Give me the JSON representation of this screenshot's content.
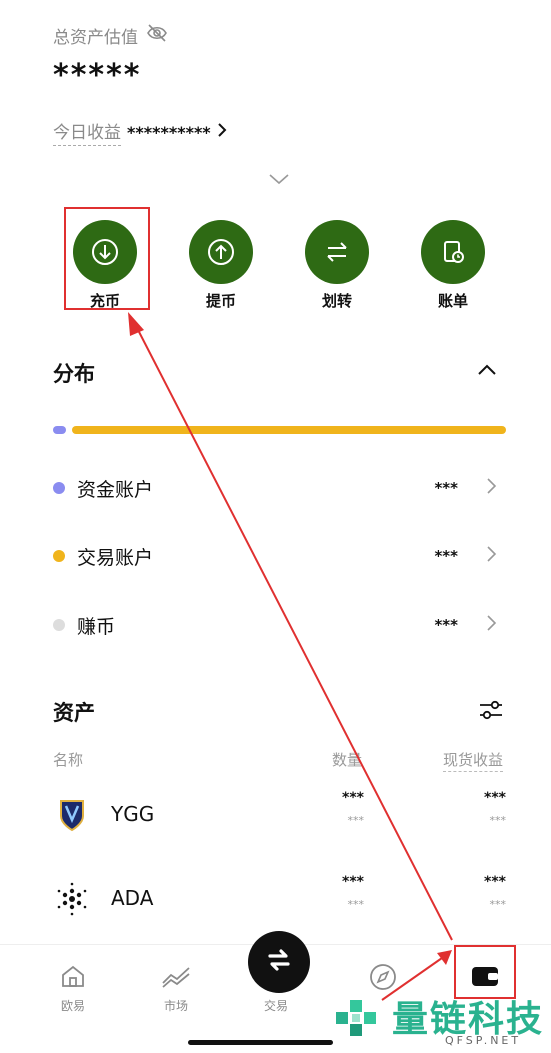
{
  "header": {
    "total_label": "总资产估值",
    "total_value": "*****",
    "today_label": "今日收益",
    "today_value": "**********"
  },
  "actions": [
    {
      "label": "充币",
      "icon": "deposit-icon"
    },
    {
      "label": "提币",
      "icon": "withdraw-icon"
    },
    {
      "label": "划转",
      "icon": "transfer-icon"
    },
    {
      "label": "账单",
      "icon": "bill-icon"
    }
  ],
  "distribution": {
    "title": "分布",
    "bar": [
      {
        "name": "资金账户",
        "share": 0.03,
        "color": "#8a8cf0"
      },
      {
        "name": "交易账户",
        "share": 0.97,
        "color": "#f0b41c"
      }
    ],
    "accounts": [
      {
        "name": "资金账户",
        "value": "***",
        "color": "#8a8cf0"
      },
      {
        "name": "交易账户",
        "value": "***",
        "color": "#f0b41c"
      },
      {
        "name": "赚币",
        "value": "***",
        "color": "#dddddd"
      }
    ]
  },
  "assets": {
    "title": "资产",
    "col_name": "名称",
    "col_qty": "数量",
    "col_pnl": "现货收益",
    "rows": [
      {
        "symbol": "YGG",
        "qty": "***",
        "qty_sub": "***",
        "pnl": "***",
        "pnl_sub": "***"
      },
      {
        "symbol": "ADA",
        "qty": "***",
        "qty_sub": "***",
        "pnl": "***",
        "pnl_sub": "***"
      }
    ]
  },
  "tabbar": {
    "tabs": [
      "欧易",
      "市场",
      "交易"
    ]
  },
  "watermark": {
    "text": "量链科技",
    "sub": "QFSP.NET"
  },
  "colors": {
    "accent_green": "#2e6a14",
    "highlight_red": "#e03030"
  }
}
